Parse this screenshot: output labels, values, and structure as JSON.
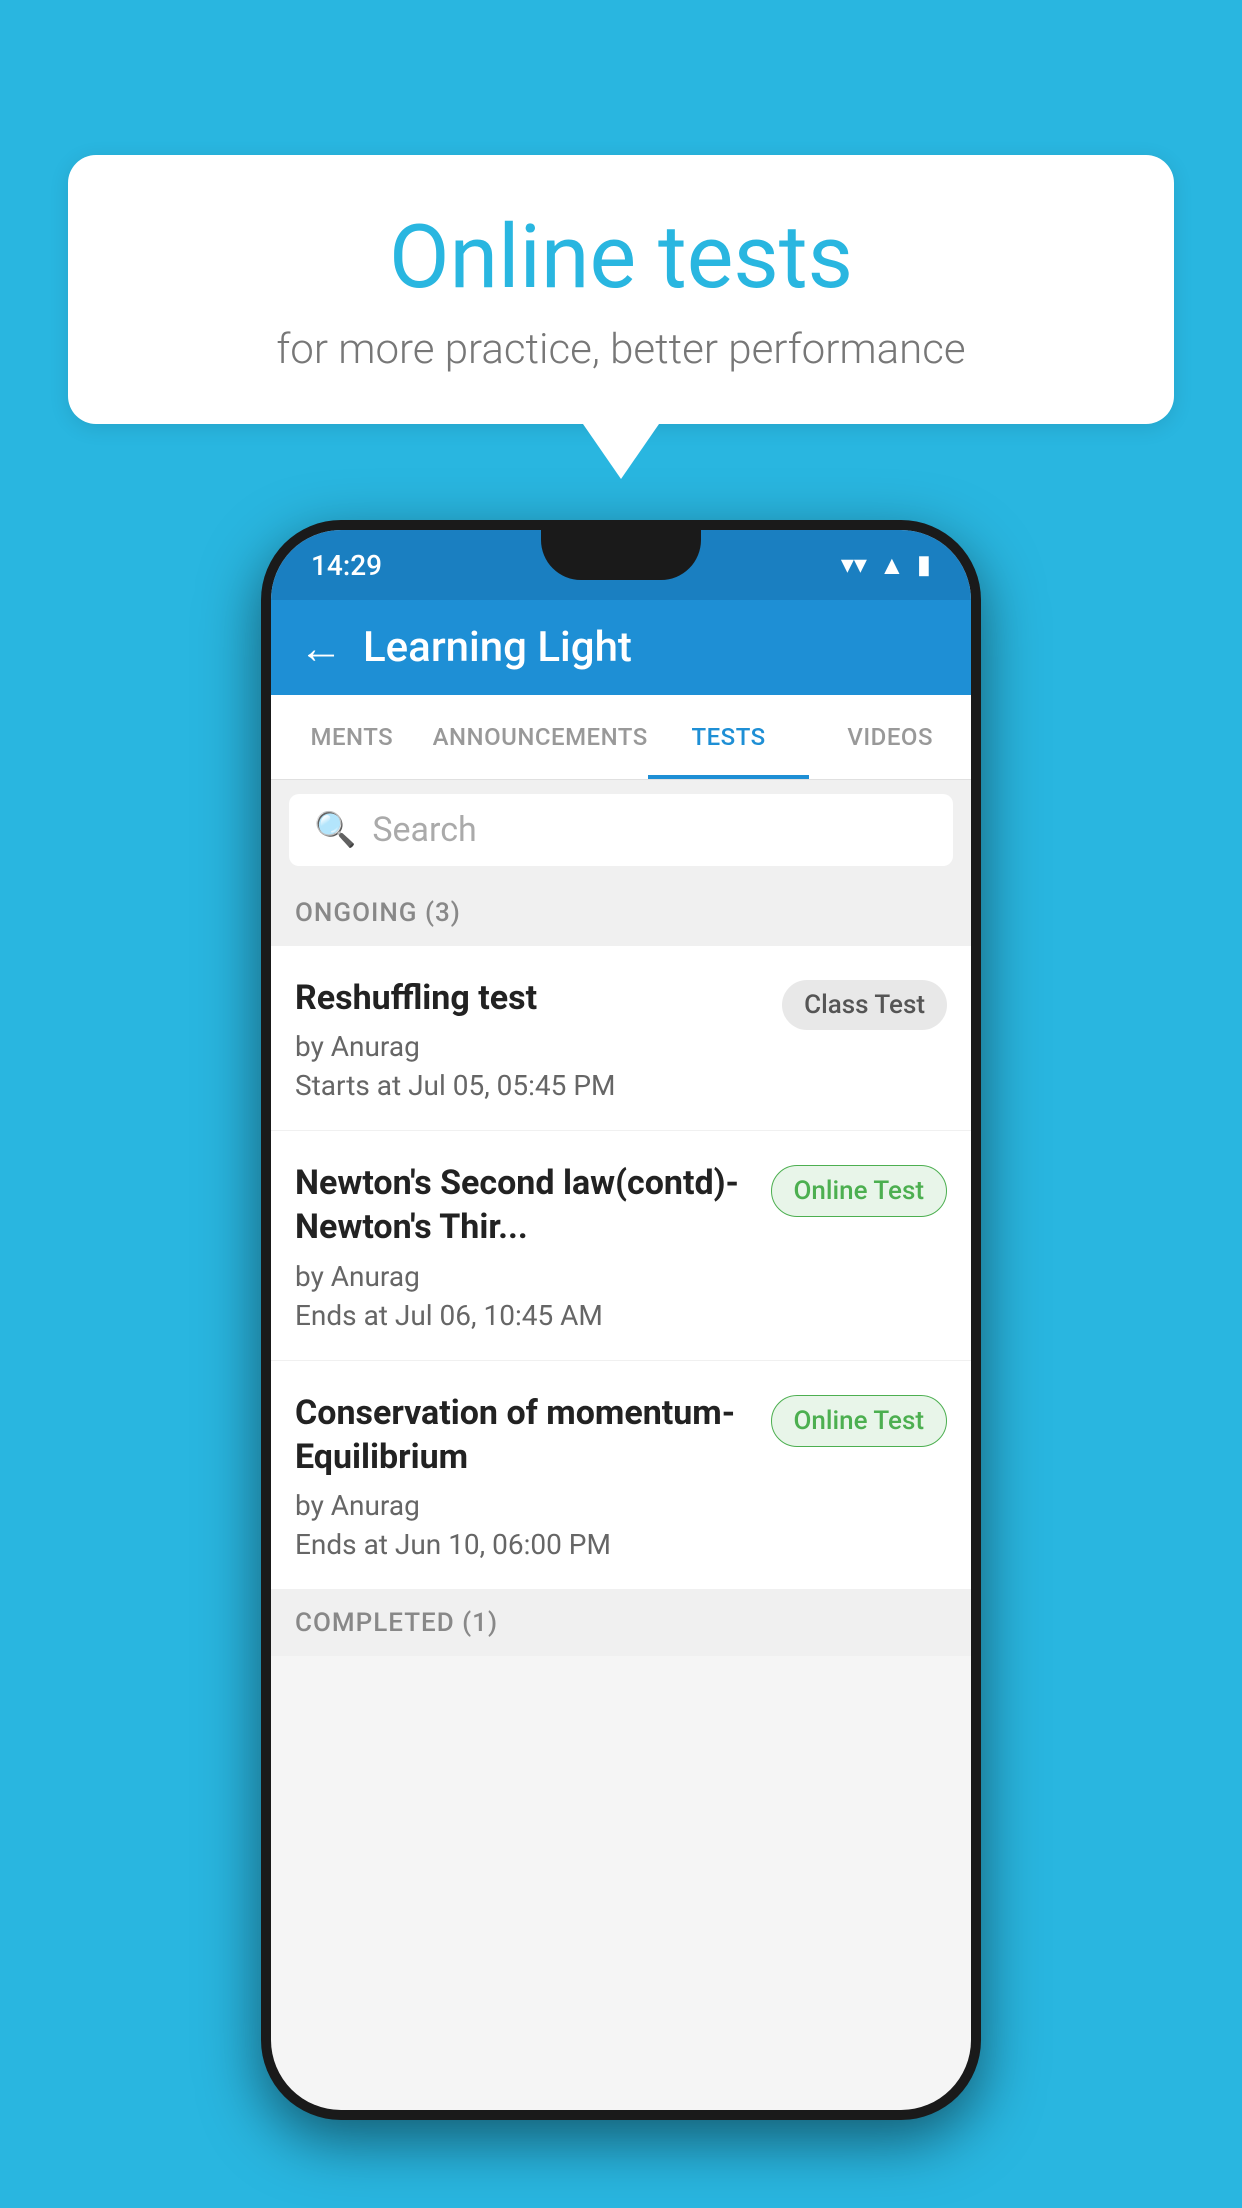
{
  "background_color": "#29b6e0",
  "bubble": {
    "title": "Online tests",
    "subtitle": "for more practice, better performance"
  },
  "phone": {
    "status_bar": {
      "time": "14:29",
      "wifi": "▾",
      "signal": "▲",
      "battery": "▮"
    },
    "header": {
      "back_label": "←",
      "title": "Learning Light"
    },
    "tabs": [
      {
        "label": "MENTS",
        "active": false
      },
      {
        "label": "ANNOUNCEMENTS",
        "active": false
      },
      {
        "label": "TESTS",
        "active": true
      },
      {
        "label": "VIDEOS",
        "active": false
      }
    ],
    "search": {
      "placeholder": "Search"
    },
    "sections": [
      {
        "title": "ONGOING (3)",
        "tests": [
          {
            "name": "Reshuffling test",
            "author": "by Anurag",
            "date": "Starts at  Jul 05, 05:45 PM",
            "badge": "Class Test",
            "badge_type": "class"
          },
          {
            "name": "Newton's Second law(contd)-Newton's Thir...",
            "author": "by Anurag",
            "date": "Ends at  Jul 06, 10:45 AM",
            "badge": "Online Test",
            "badge_type": "online"
          },
          {
            "name": "Conservation of momentum-Equilibrium",
            "author": "by Anurag",
            "date": "Ends at  Jun 10, 06:00 PM",
            "badge": "Online Test",
            "badge_type": "online"
          }
        ]
      }
    ],
    "completed_label": "COMPLETED (1)"
  }
}
